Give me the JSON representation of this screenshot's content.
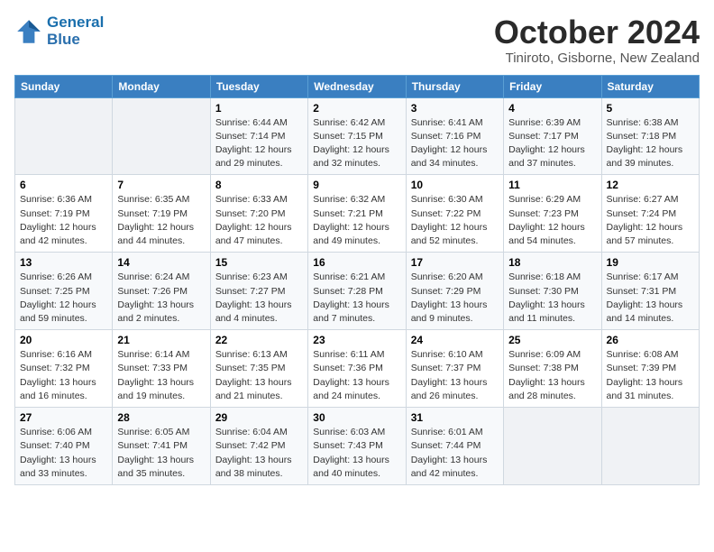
{
  "header": {
    "logo_line1": "General",
    "logo_line2": "Blue",
    "month_title": "October 2024",
    "location": "Tiniroto, Gisborne, New Zealand"
  },
  "days_of_week": [
    "Sunday",
    "Monday",
    "Tuesday",
    "Wednesday",
    "Thursday",
    "Friday",
    "Saturday"
  ],
  "weeks": [
    [
      {
        "day": "",
        "info": ""
      },
      {
        "day": "",
        "info": ""
      },
      {
        "day": "1",
        "sunrise": "6:44 AM",
        "sunset": "7:14 PM",
        "daylight": "12 hours and 29 minutes."
      },
      {
        "day": "2",
        "sunrise": "6:42 AM",
        "sunset": "7:15 PM",
        "daylight": "12 hours and 32 minutes."
      },
      {
        "day": "3",
        "sunrise": "6:41 AM",
        "sunset": "7:16 PM",
        "daylight": "12 hours and 34 minutes."
      },
      {
        "day": "4",
        "sunrise": "6:39 AM",
        "sunset": "7:17 PM",
        "daylight": "12 hours and 37 minutes."
      },
      {
        "day": "5",
        "sunrise": "6:38 AM",
        "sunset": "7:18 PM",
        "daylight": "12 hours and 39 minutes."
      }
    ],
    [
      {
        "day": "6",
        "sunrise": "6:36 AM",
        "sunset": "7:19 PM",
        "daylight": "12 hours and 42 minutes."
      },
      {
        "day": "7",
        "sunrise": "6:35 AM",
        "sunset": "7:19 PM",
        "daylight": "12 hours and 44 minutes."
      },
      {
        "day": "8",
        "sunrise": "6:33 AM",
        "sunset": "7:20 PM",
        "daylight": "12 hours and 47 minutes."
      },
      {
        "day": "9",
        "sunrise": "6:32 AM",
        "sunset": "7:21 PM",
        "daylight": "12 hours and 49 minutes."
      },
      {
        "day": "10",
        "sunrise": "6:30 AM",
        "sunset": "7:22 PM",
        "daylight": "12 hours and 52 minutes."
      },
      {
        "day": "11",
        "sunrise": "6:29 AM",
        "sunset": "7:23 PM",
        "daylight": "12 hours and 54 minutes."
      },
      {
        "day": "12",
        "sunrise": "6:27 AM",
        "sunset": "7:24 PM",
        "daylight": "12 hours and 57 minutes."
      }
    ],
    [
      {
        "day": "13",
        "sunrise": "6:26 AM",
        "sunset": "7:25 PM",
        "daylight": "12 hours and 59 minutes."
      },
      {
        "day": "14",
        "sunrise": "6:24 AM",
        "sunset": "7:26 PM",
        "daylight": "13 hours and 2 minutes."
      },
      {
        "day": "15",
        "sunrise": "6:23 AM",
        "sunset": "7:27 PM",
        "daylight": "13 hours and 4 minutes."
      },
      {
        "day": "16",
        "sunrise": "6:21 AM",
        "sunset": "7:28 PM",
        "daylight": "13 hours and 7 minutes."
      },
      {
        "day": "17",
        "sunrise": "6:20 AM",
        "sunset": "7:29 PM",
        "daylight": "13 hours and 9 minutes."
      },
      {
        "day": "18",
        "sunrise": "6:18 AM",
        "sunset": "7:30 PM",
        "daylight": "13 hours and 11 minutes."
      },
      {
        "day": "19",
        "sunrise": "6:17 AM",
        "sunset": "7:31 PM",
        "daylight": "13 hours and 14 minutes."
      }
    ],
    [
      {
        "day": "20",
        "sunrise": "6:16 AM",
        "sunset": "7:32 PM",
        "daylight": "13 hours and 16 minutes."
      },
      {
        "day": "21",
        "sunrise": "6:14 AM",
        "sunset": "7:33 PM",
        "daylight": "13 hours and 19 minutes."
      },
      {
        "day": "22",
        "sunrise": "6:13 AM",
        "sunset": "7:35 PM",
        "daylight": "13 hours and 21 minutes."
      },
      {
        "day": "23",
        "sunrise": "6:11 AM",
        "sunset": "7:36 PM",
        "daylight": "13 hours and 24 minutes."
      },
      {
        "day": "24",
        "sunrise": "6:10 AM",
        "sunset": "7:37 PM",
        "daylight": "13 hours and 26 minutes."
      },
      {
        "day": "25",
        "sunrise": "6:09 AM",
        "sunset": "7:38 PM",
        "daylight": "13 hours and 28 minutes."
      },
      {
        "day": "26",
        "sunrise": "6:08 AM",
        "sunset": "7:39 PM",
        "daylight": "13 hours and 31 minutes."
      }
    ],
    [
      {
        "day": "27",
        "sunrise": "6:06 AM",
        "sunset": "7:40 PM",
        "daylight": "13 hours and 33 minutes."
      },
      {
        "day": "28",
        "sunrise": "6:05 AM",
        "sunset": "7:41 PM",
        "daylight": "13 hours and 35 minutes."
      },
      {
        "day": "29",
        "sunrise": "6:04 AM",
        "sunset": "7:42 PM",
        "daylight": "13 hours and 38 minutes."
      },
      {
        "day": "30",
        "sunrise": "6:03 AM",
        "sunset": "7:43 PM",
        "daylight": "13 hours and 40 minutes."
      },
      {
        "day": "31",
        "sunrise": "6:01 AM",
        "sunset": "7:44 PM",
        "daylight": "13 hours and 42 minutes."
      },
      {
        "day": "",
        "info": ""
      },
      {
        "day": "",
        "info": ""
      }
    ]
  ],
  "labels": {
    "sunrise_prefix": "Sunrise: ",
    "sunset_prefix": "Sunset: ",
    "daylight_prefix": "Daylight: "
  }
}
